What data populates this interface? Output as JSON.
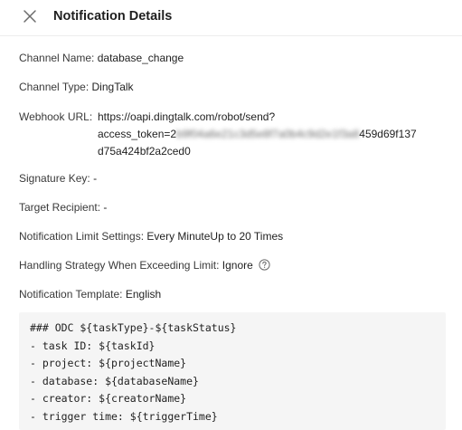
{
  "header": {
    "title": "Notification Details"
  },
  "fields": {
    "channel_name": {
      "label": "Channel Name:",
      "value": "database_change"
    },
    "channel_type": {
      "label": "Channel Type:",
      "value": "DingTalk"
    },
    "webhook_url": {
      "label": "Webhook URL:",
      "value_line1": "https://oapi.dingtalk.com/robot/send?",
      "value_line2_prefix": "access_token=2",
      "value_line2_masked": "b9f04a6e21c3d5e8f7a0b4c9d2e1f3a8",
      "value_line2_suffix": "459d69f137",
      "value_line3": "d75a424bf2a2ced0"
    },
    "signature_key": {
      "label": "Signature Key:",
      "value": "-"
    },
    "target_recipient": {
      "label": "Target Recipient:",
      "value": "-"
    },
    "notification_limit": {
      "label": "Notification Limit Settings:",
      "value": "Every MinuteUp to 20 Times"
    },
    "handling_strategy": {
      "label": "Handling Strategy When Exceeding Limit:",
      "value": "Ignore"
    },
    "notification_template": {
      "label": "Notification Template:",
      "value": "English"
    }
  },
  "template_code": [
    "### ODC ${taskType}-${taskStatus}",
    "- task ID: ${taskId}",
    "- project: ${projectName}",
    "- database: ${databaseName}",
    "- creator: ${creatorName}",
    "- trigger time: ${triggerTime}"
  ],
  "icons": {
    "close": "close-icon",
    "help": "question-circle-icon"
  }
}
